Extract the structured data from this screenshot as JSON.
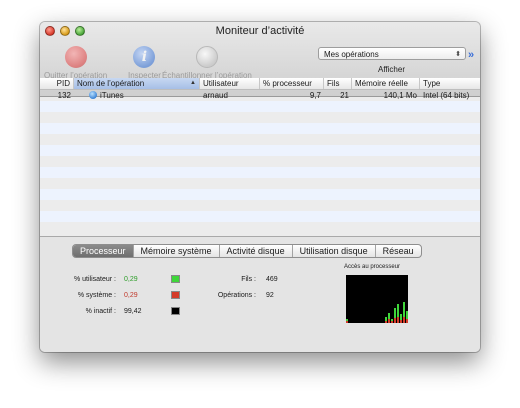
{
  "window": {
    "title": "Moniteur d’activité"
  },
  "toolbar": {
    "quit_label": "Quitter l’opération",
    "inspect_label": "Inspecter",
    "sample_label": "Échantillonner l’opération",
    "inspect_glyph": "i",
    "show_popup_value": "Mes opérations",
    "show_label": "Afficher",
    "more_glyph": "»"
  },
  "table": {
    "columns": [
      "PID",
      "Nom de l’opération",
      "Utilisateur",
      "% processeur",
      "Fils",
      "Mémoire réelle",
      "Type"
    ],
    "sort_glyph": "▲",
    "rows": [
      {
        "pid": "132",
        "name": "iTunes",
        "user": "arnaud",
        "cpu": "9,7",
        "threads": "21",
        "memory": "140,1 Mo",
        "type": "Intel (64 bits)"
      }
    ]
  },
  "tabs": [
    "Processeur",
    "Mémoire système",
    "Activité disque",
    "Utilisation disque",
    "Réseau"
  ],
  "stats": {
    "user_label": "% utilisateur :",
    "user_value": "0,29",
    "system_label": "% système :",
    "system_value": "0,29",
    "idle_label": "% inactif :",
    "idle_value": "99,42",
    "threads_label": "Fils :",
    "threads_value": "469",
    "processes_label": "Opérations :",
    "processes_value": "92",
    "graph_title": "Accès au processeur"
  },
  "colors": {
    "user": "#3fd63a",
    "system": "#d43b2a",
    "idle": "#000000",
    "accent": "#3b6fd8"
  },
  "cpu_history": [
    {
      "user": 0.02,
      "system": 0.02
    },
    {
      "user": 0.0,
      "system": 0.0
    },
    {
      "user": 0.0,
      "system": 0.0
    },
    {
      "user": 0.0,
      "system": 0.0
    },
    {
      "user": 0.0,
      "system": 0.0
    },
    {
      "user": 0.0,
      "system": 0.0
    },
    {
      "user": 0.0,
      "system": 0.0
    },
    {
      "user": 0.0,
      "system": 0.0
    },
    {
      "user": 0.0,
      "system": 0.0
    },
    {
      "user": 0.0,
      "system": 0.0
    },
    {
      "user": 0.0,
      "system": 0.0
    },
    {
      "user": 0.0,
      "system": 0.0
    },
    {
      "user": 0.0,
      "system": 0.0
    },
    {
      "user": 0.04,
      "system": 0.02
    },
    {
      "user": 0.06,
      "system": 0.04
    },
    {
      "user": 0.02,
      "system": 0.02
    },
    {
      "user": 0.1,
      "system": 0.05
    },
    {
      "user": 0.14,
      "system": 0.06
    },
    {
      "user": 0.06,
      "system": 0.03
    },
    {
      "user": 0.16,
      "system": 0.06
    },
    {
      "user": 0.08,
      "system": 0.04
    }
  ]
}
